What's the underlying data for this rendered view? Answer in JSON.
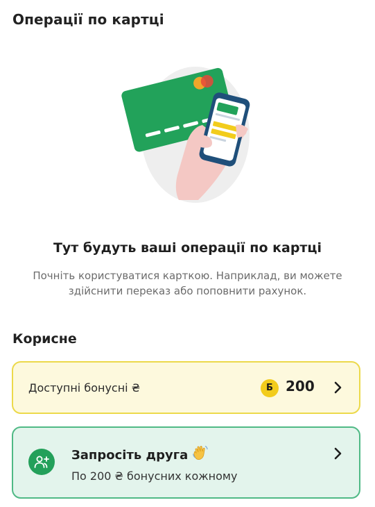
{
  "header": {
    "title": "Операції по картці"
  },
  "empty_state": {
    "illustration_icon": "card-and-phone-illustration",
    "title": "Тут будуть ваші операції по картці",
    "text_line1": "Почніть користуватися карткою. Наприклад, ви можете",
    "text_line2": "здійснити переказ або поповнити рахунок."
  },
  "useful": {
    "title": "Корисне",
    "bonus": {
      "label": "Доступні бонусні ₴",
      "badge": "Б",
      "value": "200",
      "border_color": "#ecd94a",
      "bg_color": "#fdf9dd"
    },
    "invite": {
      "icon": "add-user-icon",
      "title": "Запросіть друга",
      "emoji_icon": "waving-hand-icon",
      "subtitle": "По 200 ₴ бонусних кожному",
      "border_color": "#4fb985",
      "bg_color": "#e3f4ec",
      "icon_color": "#23a05a"
    }
  }
}
